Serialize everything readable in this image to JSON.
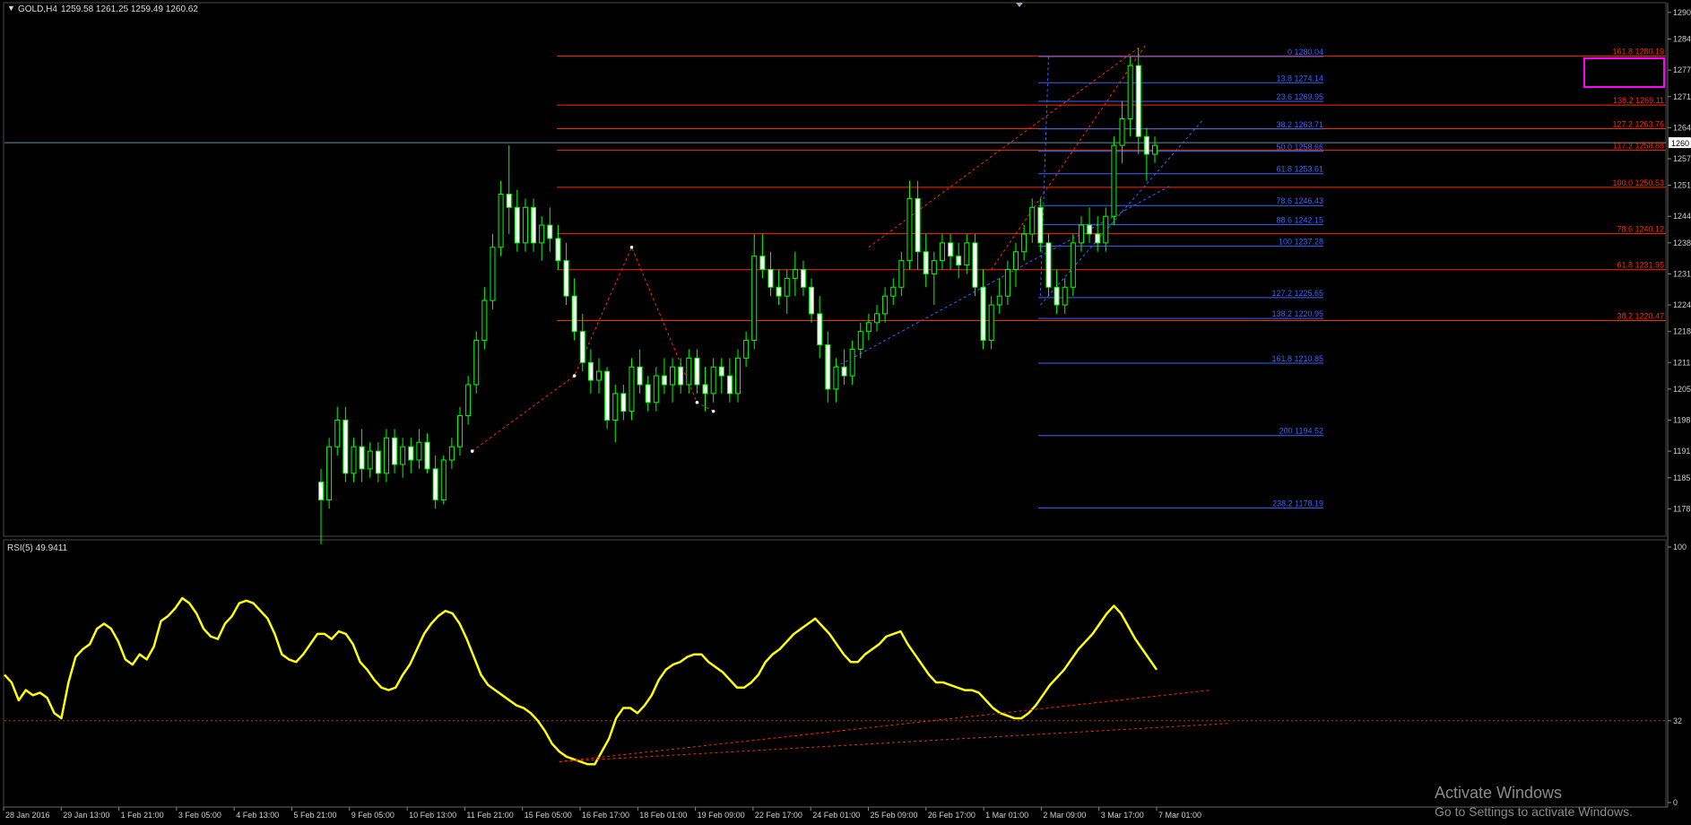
{
  "header": {
    "symbol": "GOLD,H4",
    "ohlc": "1259.58 1261.25 1259.49 1260.62"
  },
  "indicator": {
    "label": "RSI(5) 49.9411"
  },
  "colors": {
    "background": "#000000",
    "candle_bull": "#00ff00",
    "candle_bear": "#ffffff",
    "fib_red": "#ff2a00",
    "fib_blue": "#3a64ff",
    "rsi_line": "#ffff00",
    "highlight_box": "#ff00ff"
  },
  "watermark": {
    "title": "Activate Windows",
    "subtitle": "Go to Settings to activate Windows."
  },
  "chart_data": [
    {
      "type": "candlestick",
      "name": "price-chart",
      "ylim": [
        1172,
        1292
      ],
      "y_ticks": [
        1178,
        1185,
        1191,
        1198,
        1205,
        1211,
        1218,
        1224,
        1231,
        1238,
        1244,
        1251,
        1257,
        1264,
        1271,
        1277,
        1284,
        1290
      ],
      "current_price": "1260",
      "x_ticks": [
        "28 Jan 2016",
        "29 Jan 13:00",
        "1 Feb 21:00",
        "3 Feb 05:00",
        "4 Feb 13:00",
        "5 Feb 21:00",
        "9 Feb 05:00",
        "10 Feb 13:00",
        "11 Feb 21:00",
        "15 Feb 05:00",
        "16 Feb 17:00",
        "18 Feb 01:00",
        "19 Feb 09:00",
        "22 Feb 17:00",
        "24 Feb 01:00",
        "25 Feb 09:00",
        "26 Feb 17:00",
        "1 Mar 01:00",
        "2 Mar 09:00",
        "3 Mar 17:00",
        "7 Mar 01:00"
      ],
      "fib_red": [
        {
          "label": "161.8 1280.19",
          "value": 1280.19
        },
        {
          "label": "138.2 1269.11",
          "value": 1269.11
        },
        {
          "label": "127.2 1263.76",
          "value": 1263.76
        },
        {
          "label": "117.2 1258.88",
          "value": 1258.88
        },
        {
          "label": "100.0  1250.53",
          "value": 1250.53
        },
        {
          "label": "78.6 1240.12",
          "value": 1240.12
        },
        {
          "label": "61.8 1231.95",
          "value": 1231.95
        },
        {
          "label": "38.2 1220.47",
          "value": 1220.47
        }
      ],
      "fib_blue": [
        {
          "label": "0 1280.04",
          "value": 1280.04
        },
        {
          "label": "13.8 1274.14",
          "value": 1274.14
        },
        {
          "label": "23.6 1269.95",
          "value": 1269.95
        },
        {
          "label": "38.2 1263.71",
          "value": 1263.71
        },
        {
          "label": "50.0 1258.66",
          "value": 1258.66
        },
        {
          "label": "61.8 1253.61",
          "value": 1253.61
        },
        {
          "label": "78.6 1246.43",
          "value": 1246.43
        },
        {
          "label": "88.6 1242.15",
          "value": 1242.15
        },
        {
          "label": "100 1237.28",
          "value": 1237.28
        },
        {
          "label": "127.2 1225.65",
          "value": 1225.65
        },
        {
          "label": "138.2 1220.95",
          "value": 1220.95
        },
        {
          "label": "161.8 1210.85",
          "value": 1210.85
        },
        {
          "label": "200 1194.52",
          "value": 1194.52
        },
        {
          "label": "238.2 1178.19",
          "value": 1178.19
        }
      ],
      "candles": [
        [
          1184,
          1187,
          1170,
          1180
        ],
        [
          1180,
          1194,
          1178,
          1192
        ],
        [
          1192,
          1201,
          1190,
          1198
        ],
        [
          1198,
          1201,
          1184,
          1186
        ],
        [
          1186,
          1194,
          1184,
          1192
        ],
        [
          1192,
          1196,
          1184,
          1187
        ],
        [
          1187,
          1193,
          1185,
          1191
        ],
        [
          1191,
          1193,
          1184,
          1186
        ],
        [
          1186,
          1196,
          1184,
          1194
        ],
        [
          1194,
          1196,
          1186,
          1188
        ],
        [
          1188,
          1194,
          1185,
          1192
        ],
        [
          1192,
          1194,
          1186,
          1189
        ],
        [
          1189,
          1196,
          1187,
          1193
        ],
        [
          1193,
          1195,
          1186,
          1187
        ],
        [
          1187,
          1190,
          1178,
          1180
        ],
        [
          1180,
          1190,
          1179,
          1189
        ],
        [
          1189,
          1194,
          1187,
          1192
        ],
        [
          1192,
          1201,
          1190,
          1199
        ],
        [
          1199,
          1208,
          1197,
          1206
        ],
        [
          1206,
          1218,
          1204,
          1216
        ],
        [
          1216,
          1228,
          1214,
          1225
        ],
        [
          1225,
          1240,
          1223,
          1237
        ],
        [
          1237,
          1252,
          1235,
          1249
        ],
        [
          1249,
          1260,
          1240,
          1246
        ],
        [
          1246,
          1250,
          1236,
          1238
        ],
        [
          1238,
          1248,
          1236,
          1246
        ],
        [
          1246,
          1248,
          1236,
          1238
        ],
        [
          1238,
          1244,
          1234,
          1242
        ],
        [
          1242,
          1246,
          1236,
          1239
        ],
        [
          1239,
          1242,
          1232,
          1234
        ],
        [
          1234,
          1238,
          1224,
          1226
        ],
        [
          1226,
          1230,
          1216,
          1218
        ],
        [
          1218,
          1222,
          1209,
          1211
        ],
        [
          1211,
          1214,
          1204,
          1207
        ],
        [
          1207,
          1212,
          1204,
          1209
        ],
        [
          1209,
          1210,
          1196,
          1198
        ],
        [
          1198,
          1206,
          1193,
          1204
        ],
        [
          1204,
          1206,
          1198,
          1200
        ],
        [
          1200,
          1212,
          1198,
          1210
        ],
        [
          1210,
          1214,
          1204,
          1206
        ],
        [
          1206,
          1208,
          1200,
          1202
        ],
        [
          1202,
          1210,
          1200,
          1208
        ],
        [
          1208,
          1212,
          1204,
          1206
        ],
        [
          1206,
          1212,
          1202,
          1210
        ],
        [
          1210,
          1212,
          1204,
          1206
        ],
        [
          1206,
          1214,
          1204,
          1212
        ],
        [
          1212,
          1214,
          1204,
          1206
        ],
        [
          1206,
          1210,
          1200,
          1204
        ],
        [
          1204,
          1212,
          1202,
          1210
        ],
        [
          1210,
          1212,
          1204,
          1208
        ],
        [
          1208,
          1212,
          1202,
          1204
        ],
        [
          1204,
          1214,
          1202,
          1212
        ],
        [
          1212,
          1218,
          1210,
          1216
        ],
        [
          1216,
          1240,
          1214,
          1235
        ],
        [
          1235,
          1240,
          1230,
          1232
        ],
        [
          1232,
          1236,
          1226,
          1228
        ],
        [
          1228,
          1232,
          1224,
          1226
        ],
        [
          1226,
          1232,
          1222,
          1230
        ],
        [
          1230,
          1236,
          1226,
          1232
        ],
        [
          1232,
          1234,
          1226,
          1228
        ],
        [
          1228,
          1230,
          1220,
          1222
        ],
        [
          1222,
          1226,
          1212,
          1215
        ],
        [
          1215,
          1218,
          1202,
          1205
        ],
        [
          1205,
          1212,
          1202,
          1210
        ],
        [
          1210,
          1214,
          1206,
          1208
        ],
        [
          1208,
          1216,
          1206,
          1214
        ],
        [
          1214,
          1220,
          1212,
          1218
        ],
        [
          1218,
          1222,
          1216,
          1220
        ],
        [
          1220,
          1224,
          1218,
          1222
        ],
        [
          1222,
          1228,
          1220,
          1226
        ],
        [
          1226,
          1230,
          1224,
          1228
        ],
        [
          1228,
          1236,
          1226,
          1234
        ],
        [
          1234,
          1252,
          1232,
          1248
        ],
        [
          1248,
          1252,
          1232,
          1236
        ],
        [
          1236,
          1240,
          1228,
          1231
        ],
        [
          1231,
          1236,
          1224,
          1234
        ],
        [
          1234,
          1240,
          1232,
          1238
        ],
        [
          1238,
          1240,
          1232,
          1235
        ],
        [
          1235,
          1238,
          1230,
          1233
        ],
        [
          1233,
          1240,
          1231,
          1238
        ],
        [
          1238,
          1240,
          1226,
          1228
        ],
        [
          1228,
          1232,
          1214,
          1216
        ],
        [
          1216,
          1226,
          1214,
          1224
        ],
        [
          1224,
          1230,
          1222,
          1226
        ],
        [
          1226,
          1234,
          1224,
          1232
        ],
        [
          1232,
          1238,
          1228,
          1236
        ],
        [
          1236,
          1242,
          1234,
          1240
        ],
        [
          1240,
          1248,
          1238,
          1246
        ],
        [
          1246,
          1248,
          1236,
          1238
        ],
        [
          1238,
          1240,
          1226,
          1228
        ],
        [
          1228,
          1232,
          1222,
          1224
        ],
        [
          1224,
          1230,
          1222,
          1228
        ],
        [
          1228,
          1240,
          1226,
          1238
        ],
        [
          1238,
          1244,
          1236,
          1242
        ],
        [
          1242,
          1246,
          1238,
          1240
        ],
        [
          1240,
          1244,
          1236,
          1238
        ],
        [
          1238,
          1246,
          1236,
          1244
        ],
        [
          1244,
          1262,
          1242,
          1260
        ],
        [
          1260,
          1270,
          1256,
          1266
        ],
        [
          1266,
          1280,
          1262,
          1278
        ],
        [
          1278,
          1282,
          1258,
          1262
        ],
        [
          1262,
          1264,
          1252,
          1258
        ],
        [
          1258,
          1262,
          1256,
          1260
        ]
      ]
    },
    {
      "type": "line",
      "name": "rsi-chart",
      "ylim": [
        0,
        100
      ],
      "y_ticks": [
        100,
        32,
        0
      ],
      "level_line": 32,
      "values": [
        50,
        47,
        40,
        44,
        42,
        43,
        41,
        35,
        33,
        47,
        57,
        60,
        62,
        68,
        70,
        68,
        63,
        56,
        54,
        58,
        56,
        61,
        71,
        73,
        76,
        80,
        78,
        74,
        68,
        65,
        64,
        70,
        73,
        78,
        79,
        78,
        75,
        72,
        66,
        58,
        56,
        55,
        58,
        62,
        66,
        66,
        64,
        67,
        66,
        62,
        55,
        52,
        48,
        45,
        44,
        45,
        50,
        54,
        60,
        66,
        70,
        73,
        75,
        74,
        70,
        64,
        57,
        50,
        46,
        44,
        42,
        40,
        38,
        37,
        35,
        32,
        28,
        23,
        20,
        18,
        17,
        16,
        15,
        15,
        20,
        25,
        33,
        37,
        37,
        35,
        38,
        42,
        48,
        52,
        54,
        55,
        57,
        58,
        58,
        55,
        53,
        51,
        48,
        45,
        45,
        47,
        50,
        55,
        58,
        60,
        63,
        66,
        68,
        70,
        72,
        69,
        66,
        62,
        58,
        55,
        55,
        58,
        60,
        62,
        65,
        66,
        67,
        62,
        58,
        54,
        50,
        47,
        47,
        46,
        45,
        44,
        44,
        43,
        40,
        37,
        35,
        34,
        33,
        33,
        35,
        38,
        42,
        46,
        49,
        52,
        56,
        60,
        63,
        66,
        70,
        74,
        77,
        74,
        69,
        64,
        60,
        56,
        52
      ],
      "trendlines": "dashed"
    }
  ]
}
